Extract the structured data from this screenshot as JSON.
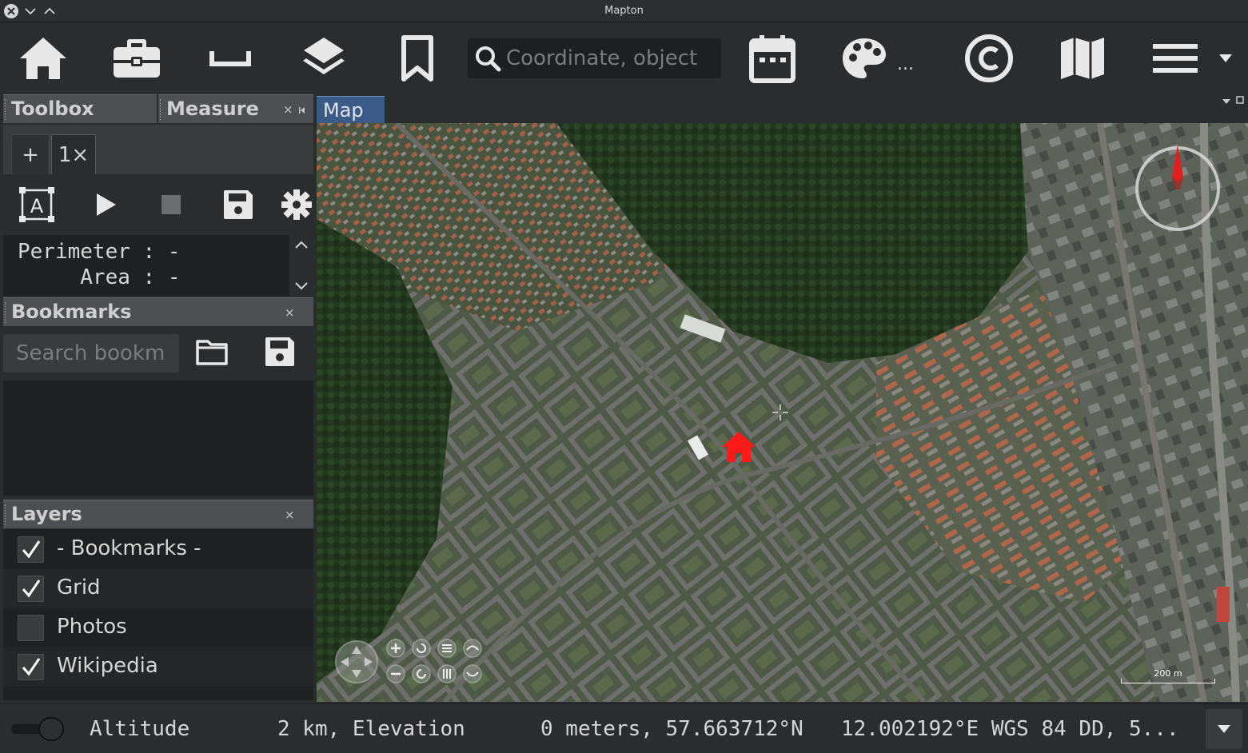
{
  "window": {
    "title": "Mapton"
  },
  "toolbar": {
    "search_placeholder": "Coordinate, object",
    "palette_ellipsis": "...",
    "icons": [
      "home-icon",
      "toolbox-icon",
      "measure-icon",
      "layers-icon",
      "bookmark-icon",
      "search-icon",
      "calendar-icon",
      "palette-icon",
      "copyright-icon",
      "map-icon",
      "menu-icon"
    ]
  },
  "left_panel": {
    "toolbox_tab": "Toolbox",
    "measure_tab": "Measure",
    "close_glyph": "×",
    "measure_tabs": [
      {
        "label": "+"
      },
      {
        "label": "1×"
      }
    ],
    "measure_output": {
      "perimeter_line": "Perimeter : -",
      "area_line": "     Area : -"
    },
    "bookmarks": {
      "title": "Bookmarks",
      "search_placeholder": "Search bookm"
    },
    "layers": {
      "title": "Layers",
      "items": [
        {
          "label": "- Bookmarks -",
          "checked": true
        },
        {
          "label": "Grid",
          "checked": true
        },
        {
          "label": "Photos",
          "checked": false
        },
        {
          "label": "Wikipedia",
          "checked": true
        }
      ]
    }
  },
  "map": {
    "tab_label": "Map",
    "scale_label": "200 m",
    "colors": {
      "marker": "#ff1a1a",
      "compass_needle": "#e02020"
    }
  },
  "status": {
    "altitude_label": "Altitude",
    "seg1": "2 km, Elevation",
    "seg2": "0 meters, 57.663712°N",
    "seg3": "12.002192°E WGS 84 DD, 5..."
  }
}
